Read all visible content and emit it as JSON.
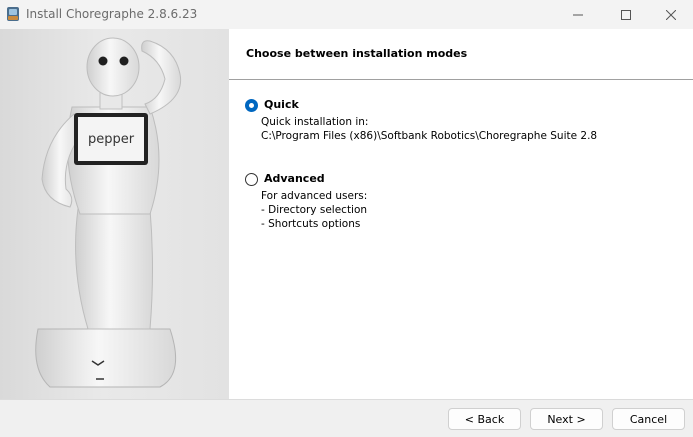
{
  "window": {
    "title": "Install Choregraphe 2.8.6.23"
  },
  "header": {
    "title": "Choose between installation modes"
  },
  "image": {
    "robot_screen_text": "pepper"
  },
  "options": [
    {
      "label": "Quick",
      "selected": true,
      "lines": [
        "Quick installation in:",
        "C:\\Program Files (x86)\\Softbank Robotics\\Choregraphe Suite 2.8"
      ]
    },
    {
      "label": "Advanced",
      "selected": false,
      "lines": [
        "For advanced users:",
        "- Directory selection",
        "- Shortcuts options"
      ]
    }
  ],
  "buttons": {
    "back": "< Back",
    "next": "Next >",
    "cancel": "Cancel"
  },
  "colors": {
    "radio_selected": "#0067c0"
  },
  "icons": [
    "installer-icon",
    "minimize-icon",
    "maximize-icon",
    "close-icon"
  ]
}
